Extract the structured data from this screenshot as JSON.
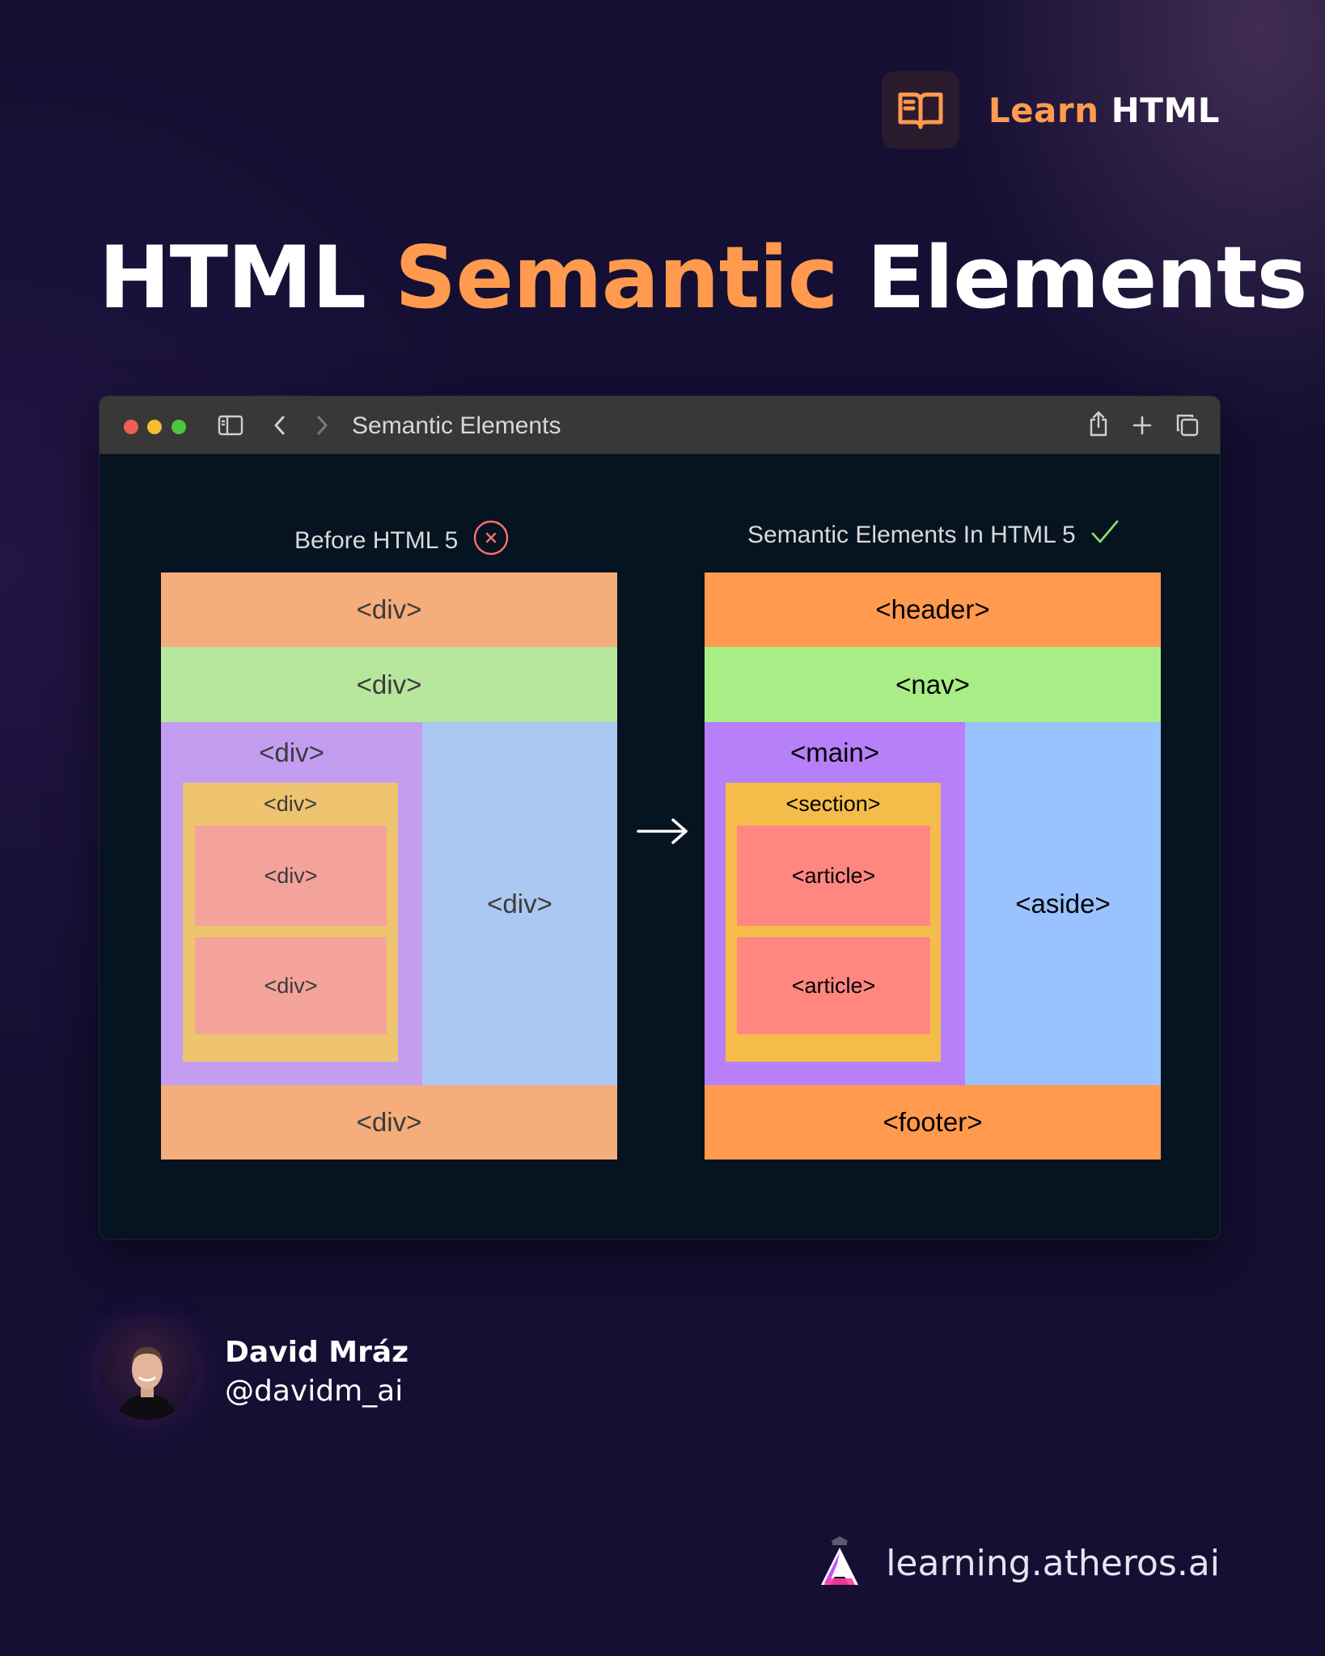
{
  "brand": {
    "accent_word": "Learn",
    "plain_word": "HTML",
    "icon": "open-book-icon",
    "accent_color": "#ff9a4f"
  },
  "title": {
    "part1": "HTML",
    "part2": "Semantic",
    "part3": "Elements"
  },
  "window": {
    "tab_title": "Semantic Elements",
    "icons": [
      "sidebar-icon",
      "back-icon",
      "forward-icon",
      "share-icon",
      "plus-icon",
      "tabs-icon"
    ]
  },
  "diagram": {
    "before": {
      "label": "Before HTML 5",
      "status_icon": "x-circle-icon",
      "header": "<div>",
      "nav": "<div>",
      "main": "<div>",
      "section": "<div>",
      "article1": "<div>",
      "article2": "<div>",
      "aside": "<div>",
      "footer": "<div>"
    },
    "after": {
      "label": "Semantic Elements In HTML 5",
      "status_icon": "check-icon",
      "header": "<header>",
      "nav": "<nav>",
      "main": "<main>",
      "section": "<section>",
      "article1": "<article>",
      "article2": "<article>",
      "aside": "<aside>",
      "footer": "<footer>"
    },
    "arrow_icon": "right-arrow-icon"
  },
  "author": {
    "name": "David Mráz",
    "handle": "@davidm_ai"
  },
  "footer": {
    "site": "learning.atheros.ai",
    "logo": "atheros-logo-icon"
  }
}
